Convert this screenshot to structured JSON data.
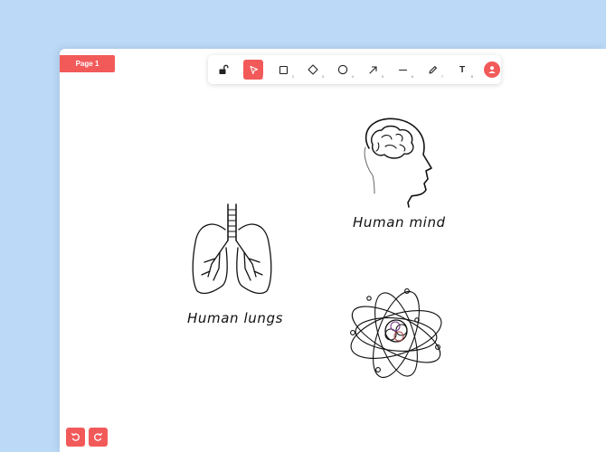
{
  "page_tab": {
    "label": "Page 1"
  },
  "toolbar": {
    "tools": [
      {
        "name": "lock",
        "icon": "lock-open-icon",
        "active": false,
        "shortcut": ""
      },
      {
        "name": "select",
        "icon": "cursor-arrow-icon",
        "active": true,
        "shortcut": "1"
      },
      {
        "name": "rectangle",
        "icon": "square-icon",
        "active": false,
        "shortcut": "2"
      },
      {
        "name": "diamond",
        "icon": "diamond-icon",
        "active": false,
        "shortcut": "3"
      },
      {
        "name": "ellipse",
        "icon": "circle-icon",
        "active": false,
        "shortcut": "4"
      },
      {
        "name": "arrow",
        "icon": "arrow-icon",
        "active": false,
        "shortcut": "5"
      },
      {
        "name": "line",
        "icon": "line-icon",
        "active": false,
        "shortcut": "6"
      },
      {
        "name": "draw",
        "icon": "pencil-icon",
        "active": false,
        "shortcut": "7"
      },
      {
        "name": "text",
        "icon": "text-icon",
        "label": "T",
        "active": false,
        "shortcut": "8"
      },
      {
        "name": "collaborator",
        "icon": "user-avatar-icon",
        "active": false
      }
    ]
  },
  "canvas": {
    "labels": {
      "mind": "Human mind",
      "lungs": "Human lungs"
    },
    "drawings": [
      "brain-head-sketch",
      "lungs-sketch",
      "atom-sketch"
    ]
  },
  "history": {
    "undo_icon": "undo-icon",
    "redo_icon": "redo-icon"
  },
  "colors": {
    "accent": "#f25a5a",
    "background": "#bcdaf7",
    "canvas": "#ffffff",
    "ink": "#111111"
  }
}
